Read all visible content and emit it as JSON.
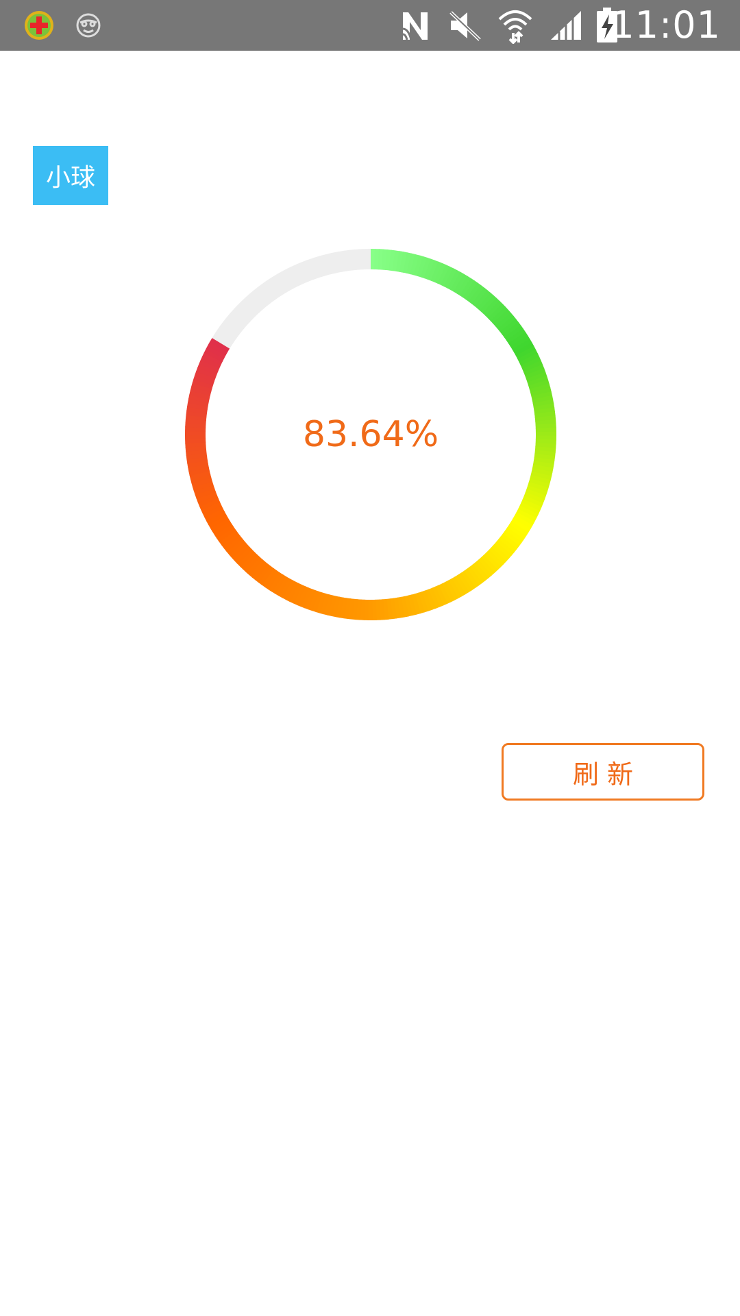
{
  "status_bar": {
    "time": "11:01",
    "left_icons": [
      "app-plus-icon",
      "smiley-mask-icon"
    ],
    "right_icons": [
      "nfc-icon",
      "mute-icon",
      "wifi-icon",
      "signal-icon",
      "battery-charging-icon"
    ]
  },
  "tag": {
    "label": "小球"
  },
  "progress": {
    "value": 83.64,
    "label": "83.64%",
    "gradient_colors": [
      "#88ff88",
      "#3fd62e",
      "#ffff00",
      "#ff9900",
      "#ff6600",
      "#e0304a"
    ],
    "track_color": "#eeeeee",
    "text_color": "#f06a18"
  },
  "actions": {
    "refresh_label": "刷  新"
  },
  "colors": {
    "status_bar": "#777777",
    "tag_bg": "#3bbdf4",
    "accent": "#f07a22"
  }
}
